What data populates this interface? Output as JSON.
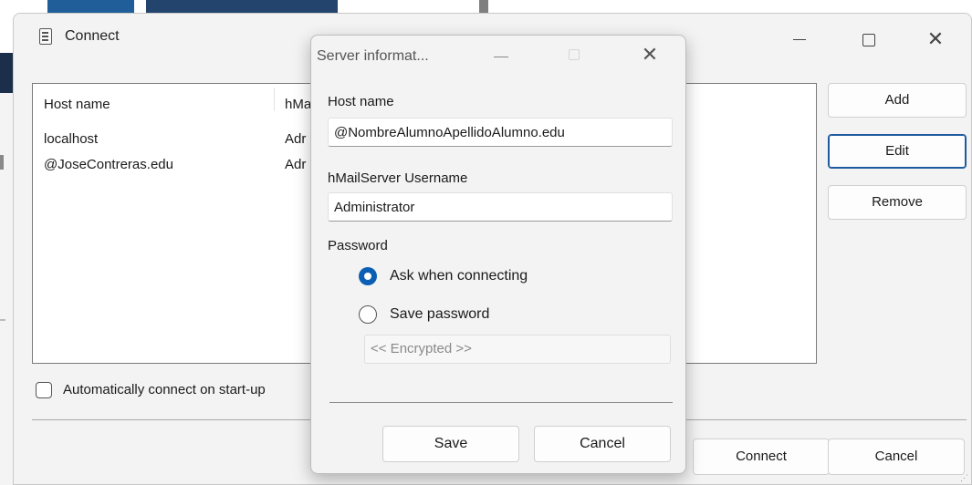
{
  "main_window": {
    "title": "Connect",
    "list": {
      "columns": [
        "Host name",
        "hMa"
      ],
      "rows": [
        {
          "host": "localhost",
          "user": "Adr"
        },
        {
          "host": "@JoseContreras.edu",
          "user": "Adr"
        }
      ]
    },
    "buttons": {
      "add": "Add",
      "edit": "Edit",
      "remove": "Remove",
      "connect": "Connect",
      "cancel": "Cancel"
    },
    "auto_connect_label": "Automatically connect on start-up",
    "auto_connect_checked": false
  },
  "dialog": {
    "title": "Server informat...",
    "host_label": "Host name",
    "host_value": "@NombreAlumnoApellidoAlumno.edu",
    "username_label": "hMailServer Username",
    "username_value": "Administrator",
    "password_label": "Password",
    "options": {
      "ask": "Ask when connecting",
      "save": "Save password"
    },
    "selected_option": "ask",
    "encrypted_placeholder": "<< Encrypted >>",
    "buttons": {
      "save": "Save",
      "cancel": "Cancel"
    }
  },
  "colors": {
    "accent": "#0a5fb4",
    "window_bg": "#f3f3f3"
  },
  "icons": [
    "document-icon",
    "minimize-icon",
    "maximize-icon",
    "close-icon",
    "resize-grip-icon"
  ]
}
